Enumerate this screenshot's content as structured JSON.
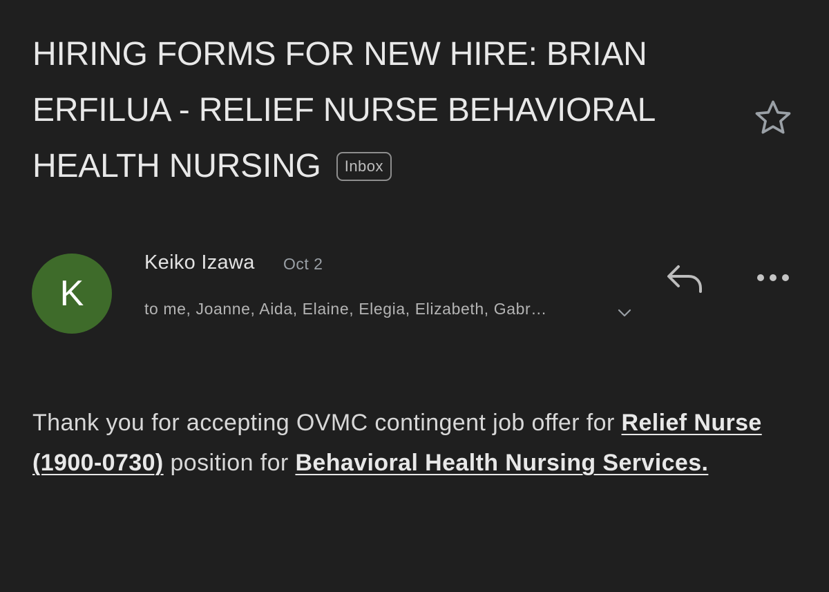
{
  "email": {
    "subject": "HIRING FORMS FOR NEW HIRE: BRIAN ERFILUA - RELIEF NURSE BEHAVIORAL HEALTH NURSING",
    "label": "Inbox",
    "sender": {
      "initial": "K",
      "name": "Keiko Izawa",
      "date": "Oct 2",
      "recipients": "to me, Joanne, Aida, Elaine, Elegia, Elizabeth, Gabr…"
    },
    "body": {
      "part1": "Thank you for accepting OVMC contingent job offer for ",
      "link1": "Relief Nurse (1900-0730)",
      "part2": " position for ",
      "link2": "Behavioral Health Nursing Services."
    }
  },
  "icons": {
    "star": "star-outline-icon",
    "reply": "reply-icon",
    "more": "more-horizontal-icon",
    "expand": "chevron-down-icon"
  },
  "colors": {
    "background": "#1f1f1f",
    "avatar": "#3e6b2a"
  }
}
